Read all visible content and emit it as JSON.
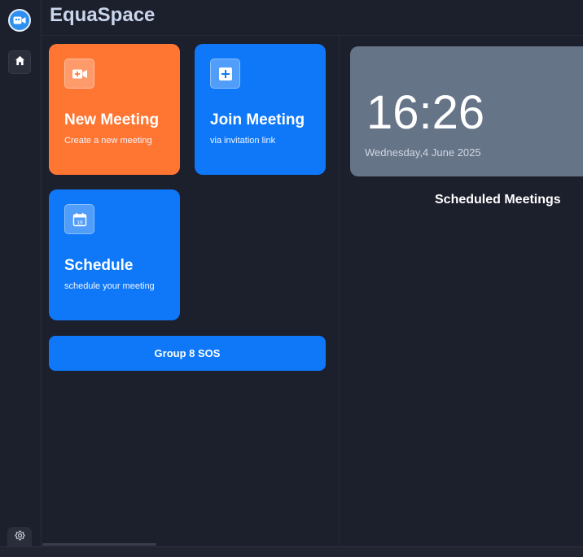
{
  "app": {
    "title": "EquaSpace"
  },
  "sidebar": {
    "logo_icon": "video-camera-logo-icon",
    "home_icon": "home-icon",
    "settings_icon": "gear-icon"
  },
  "cards": {
    "new_meeting": {
      "title": "New Meeting",
      "subtitle": "Create a new meeting",
      "icon": "video-plus-icon",
      "color": "#ff7532"
    },
    "join_meeting": {
      "title": "Join Meeting",
      "subtitle": "via invitation link",
      "icon": "plus-square-icon",
      "color": "#0e78f9"
    },
    "schedule": {
      "title": "Schedule",
      "subtitle": "schedule your meeting",
      "icon": "calendar-icon",
      "icon_text": "19",
      "color": "#0e78f9"
    }
  },
  "group_button": {
    "label": "Group 8 SOS"
  },
  "clock": {
    "time": "16:26",
    "date": "Wednesday,4 June 2025"
  },
  "scheduled": {
    "heading": "Scheduled Meetings"
  }
}
